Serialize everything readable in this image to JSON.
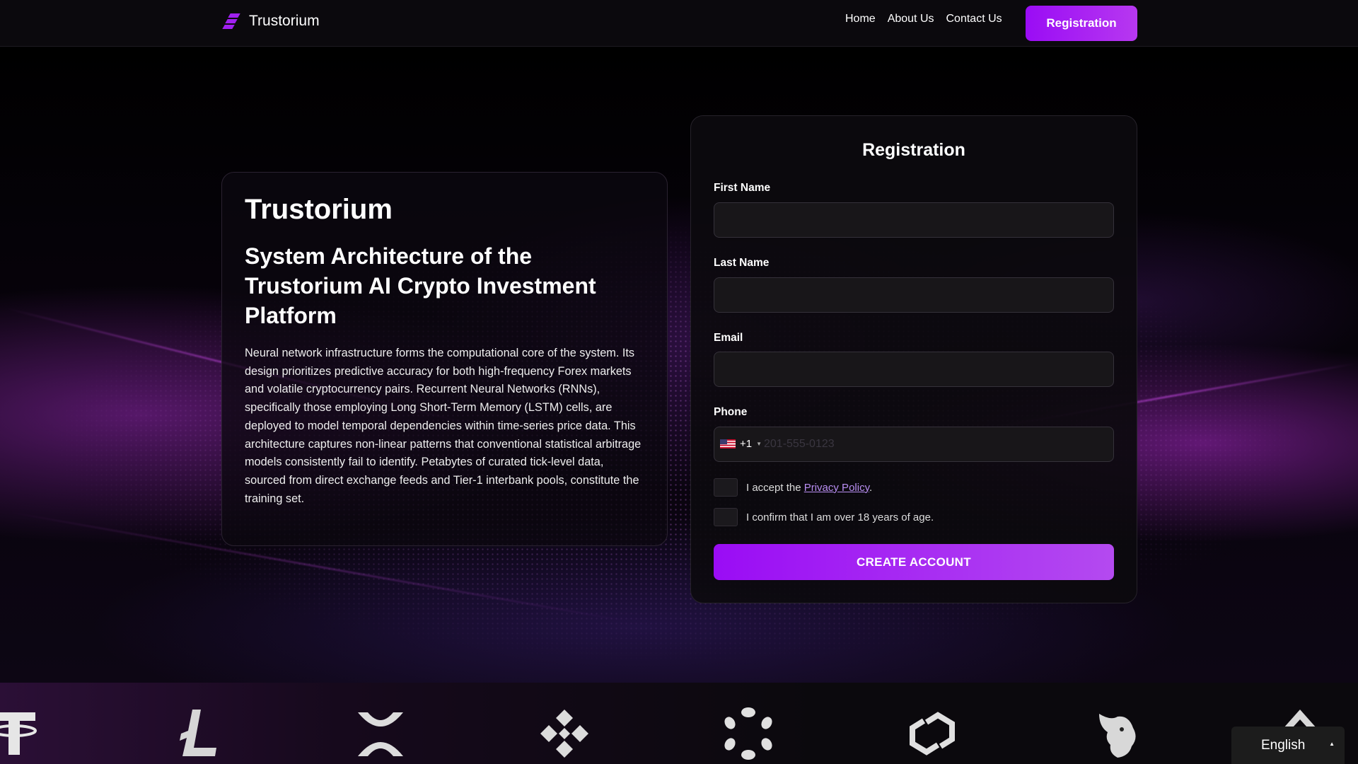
{
  "header": {
    "brand": "Trustorium",
    "nav": [
      "Home",
      "About Us",
      "Contact Us"
    ],
    "registration_button": "Registration"
  },
  "info": {
    "brand": "Trustorium",
    "heading": "System Architecture of the Trustorium AI Crypto Investment Platform",
    "body": "Neural network infrastructure forms the computational core of the system. Its design prioritizes predictive accuracy for both high-frequency Forex markets and volatile cryptocurrency pairs. Recurrent Neural Networks (RNNs), specifically those employing Long Short-Term Memory (LSTM) cells, are deployed to model temporal dependencies within time-series price data. This architecture captures non-linear patterns that conventional statistical arbitrage models consistently fail to identify. Petabytes of curated tick-level data, sourced from direct exchange feeds and Tier-1 interbank pools, constitute the training set."
  },
  "form": {
    "title": "Registration",
    "first_name_label": "First Name",
    "first_name_value": "",
    "last_name_label": "Last Name",
    "last_name_value": "",
    "email_label": "Email",
    "email_value": "",
    "phone_label": "Phone",
    "phone_country_code": "+1",
    "phone_placeholder": "201-555-0123",
    "privacy_prefix": "I accept the ",
    "privacy_link": "Privacy Policy",
    "privacy_suffix": ".",
    "age_confirm": "I confirm that I am over 18 years of age.",
    "submit": "CREATE ACCOUNT"
  },
  "ticker": {
    "coins": [
      "tether-icon",
      "litecoin-icon",
      "xrp-icon",
      "binance-icon",
      "polkadot-icon",
      "chainlink-icon",
      "uniswap-icon",
      "tron-icon"
    ]
  },
  "language": {
    "selected": "English"
  },
  "colors": {
    "accent": "#9a0cf5",
    "accent_light": "#b738f0",
    "link": "#b98ef2",
    "background": "#000000"
  }
}
